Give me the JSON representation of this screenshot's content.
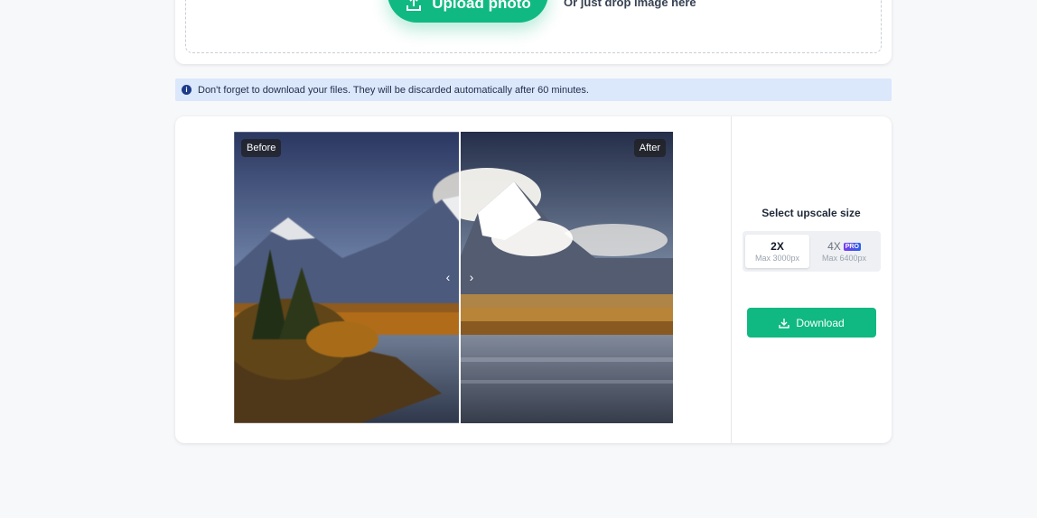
{
  "upload": {
    "button_label": "Upload photo",
    "drop_text": "Or just drop image here"
  },
  "info": {
    "icon": "info-icon",
    "message": "Don't forget to download your files. They will be discarded automatically after 60 minutes."
  },
  "compare": {
    "before_label": "Before",
    "after_label": "After"
  },
  "panel": {
    "title": "Select upscale size",
    "options": [
      {
        "label": "2X",
        "sub": "Max 3000px",
        "selected": true
      },
      {
        "label": "4X",
        "badge": "PRO",
        "sub": "Max 6400px",
        "selected": false
      }
    ],
    "download_label": "Download"
  },
  "colors": {
    "accent": "#10b981",
    "info_bg": "#dbe7fb"
  }
}
